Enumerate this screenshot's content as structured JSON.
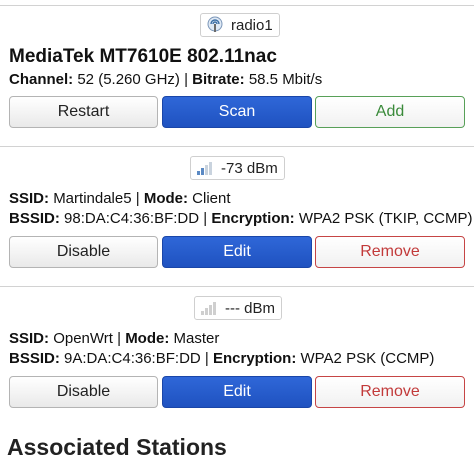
{
  "radio": {
    "badge_label": "radio1",
    "device_name": "MediaTek MT7610E 802.11nac",
    "channel_label": "Channel:",
    "channel_value": "52 (5.260 GHz)",
    "separator": "|",
    "bitrate_label": "Bitrate:",
    "bitrate_value": "58.5 Mbit/s",
    "buttons": {
      "restart": "Restart",
      "scan": "Scan",
      "add": "Add"
    }
  },
  "networks": [
    {
      "signal_label": "-73 dBm",
      "signal_icon": "signal-strength-icon",
      "ssid_label": "SSID:",
      "ssid_value": "Martindale5",
      "mode_label": "Mode:",
      "mode_value": "Client",
      "bssid_label": "BSSID:",
      "bssid_value": "98:DA:C4:36:BF:DD",
      "encryption_label": "Encryption:",
      "encryption_value": "WPA2 PSK (TKIP, CCMP)",
      "buttons": {
        "disable": "Disable",
        "edit": "Edit",
        "remove": "Remove"
      }
    },
    {
      "signal_label": "--- dBm",
      "signal_icon": "signal-none-icon",
      "ssid_label": "SSID:",
      "ssid_value": "OpenWrt",
      "mode_label": "Mode:",
      "mode_value": "Master",
      "bssid_label": "BSSID:",
      "bssid_value": "9A:DA:C4:36:BF:DD",
      "encryption_label": "Encryption:",
      "encryption_value": "WPA2 PSK (CCMP)",
      "buttons": {
        "disable": "Disable",
        "edit": "Edit",
        "remove": "Remove"
      }
    }
  ],
  "section_heading": "Associated Stations",
  "colors": {
    "primary": "#1f52c0",
    "add_border": "#58a058",
    "remove_border": "#c64545"
  }
}
